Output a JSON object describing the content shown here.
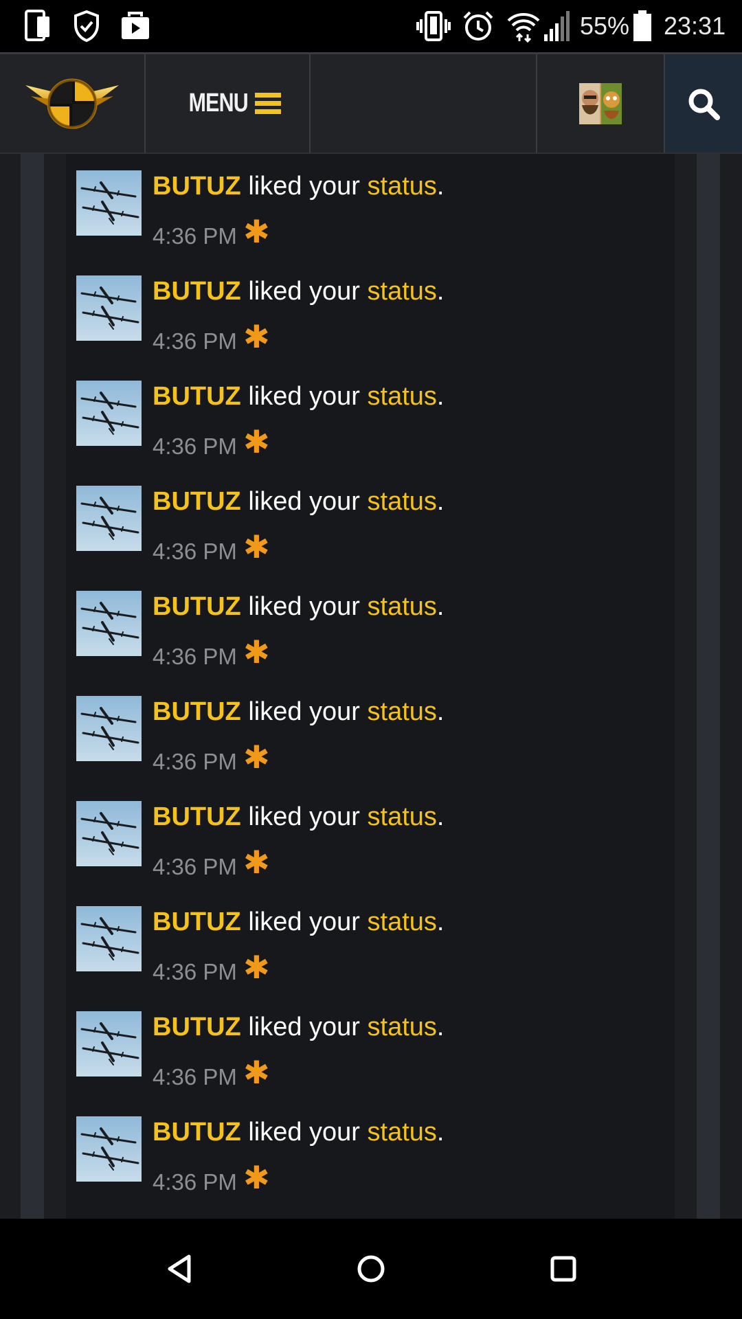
{
  "status_bar": {
    "battery": "55%",
    "time": "23:31",
    "left_icons": [
      "phone-screen-icon",
      "shield-check-icon",
      "play-store-icon"
    ],
    "right_icons": [
      "vibrate-icon",
      "alarm-icon",
      "wifi-icon",
      "signal-icon",
      "battery-icon"
    ]
  },
  "header": {
    "menu_label": "MENU",
    "icons": [
      "site-logo",
      "hamburger-icon",
      "user-avatar",
      "search-icon"
    ]
  },
  "alerts": [
    {
      "user": "BUTUZ",
      "text": " liked your ",
      "link": "status",
      "end": ".",
      "time": "4:36 PM"
    },
    {
      "user": "BUTUZ",
      "text": " liked your ",
      "link": "status",
      "end": ".",
      "time": "4:36 PM"
    },
    {
      "user": "BUTUZ",
      "text": " liked your ",
      "link": "status",
      "end": ".",
      "time": "4:36 PM"
    },
    {
      "user": "BUTUZ",
      "text": " liked your ",
      "link": "status",
      "end": ".",
      "time": "4:36 PM"
    },
    {
      "user": "BUTUZ",
      "text": " liked your ",
      "link": "status",
      "end": ".",
      "time": "4:36 PM"
    },
    {
      "user": "BUTUZ",
      "text": " liked your ",
      "link": "status",
      "end": ".",
      "time": "4:36 PM"
    },
    {
      "user": "BUTUZ",
      "text": " liked your ",
      "link": "status",
      "end": ".",
      "time": "4:36 PM"
    },
    {
      "user": "BUTUZ",
      "text": " liked your ",
      "link": "status",
      "end": ".",
      "time": "4:36 PM"
    },
    {
      "user": "BUTUZ",
      "text": " liked your ",
      "link": "status",
      "end": ".",
      "time": "4:36 PM"
    },
    {
      "user": "BUTUZ",
      "text": " liked your ",
      "link": "status",
      "end": ".",
      "time": "4:36 PM"
    }
  ],
  "new_marker": "✱",
  "colors": {
    "accent": "#f5c21b",
    "new_marker": "#f19a1a",
    "timestamp": "#8d8f93"
  },
  "nav_bar": {
    "icons": [
      "back-icon",
      "home-icon",
      "recents-icon"
    ]
  }
}
